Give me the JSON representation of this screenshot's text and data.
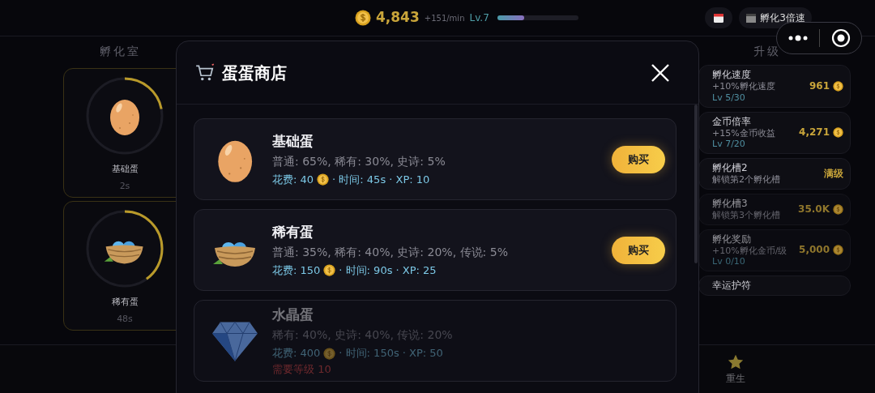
{
  "top_bar": {
    "coins": "4,843",
    "rate": "+151/min",
    "player_level": "Lv.7",
    "xp_bar": {
      "level": 0.33
    },
    "boost_button": "孵化3倍速"
  },
  "incubator": {
    "title": "孵化室",
    "slots": [
      {
        "kind": "egg",
        "name": "基础蛋",
        "time": "2s",
        "progress": {
          "level": 0.22
        }
      },
      {
        "kind": "nest",
        "name": "稀有蛋",
        "time": "48s",
        "progress": {
          "level": 0.4
        }
      }
    ]
  },
  "upgrades": {
    "title": "升级",
    "items": [
      {
        "name": "孵化速度",
        "desc": "+10%孵化速度",
        "lv": "Lv 5/30",
        "price": "961",
        "coin": true,
        "disabled": false
      },
      {
        "name": "金币倍率",
        "desc": "+15%金币收益",
        "lv": "Lv 7/20",
        "price": "4,271",
        "coin": true,
        "disabled": false
      },
      {
        "name": "孵化槽2",
        "desc": "解锁第2个孵化槽",
        "price": "满级",
        "coin": false,
        "disabled": false
      },
      {
        "name": "孵化槽3",
        "desc": "解锁第3个孵化槽",
        "price": "35.0K",
        "coin": true,
        "disabled": true
      },
      {
        "name": "孵化奖励",
        "desc": "+10%孵化金币/级",
        "lv": "Lv 0/10",
        "price": "5,000",
        "coin": true,
        "disabled": true
      },
      {
        "name": "幸运护符",
        "coin": false,
        "disabled": false
      }
    ]
  },
  "bottom_nav": [
    {
      "label": "重生"
    }
  ],
  "shop": {
    "title": "蛋蛋商店",
    "items": [
      {
        "kind": "egg",
        "name": "基础蛋",
        "odds": "普通: 65%, 稀有: 30%, 史诗: 5%",
        "cost": "花费: 40",
        "details": "· 时间: 45s · XP: 10",
        "locked": false,
        "buy": "购买"
      },
      {
        "kind": "nest",
        "name": "稀有蛋",
        "odds": "普通: 35%, 稀有: 40%, 史诗: 20%, 传说: 5%",
        "cost": "花费: 150",
        "details": "· 时间: 90s · XP: 25",
        "locked": false,
        "buy": "购买"
      },
      {
        "kind": "gem",
        "name": "水晶蛋",
        "odds": "稀有: 40%, 史诗: 40%, 传说: 20%",
        "cost": "花费: 400",
        "details": "· 时间: 150s · XP: 50",
        "locked": true,
        "requirement": "需要等级 10"
      }
    ]
  }
}
